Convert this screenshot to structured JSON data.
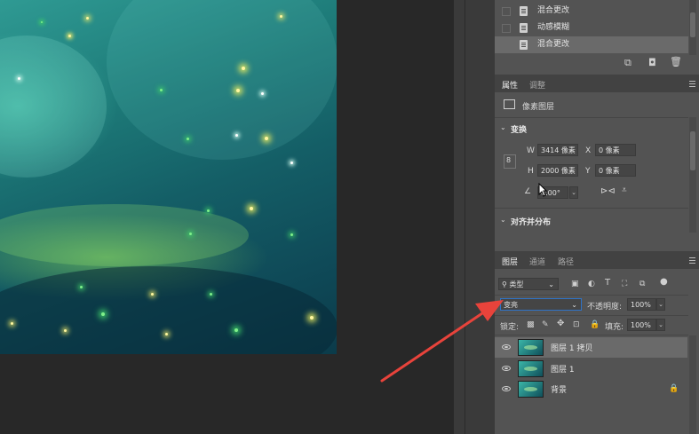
{
  "history": {
    "items": [
      {
        "label": "混合更改",
        "selected": false
      },
      {
        "label": "动感模糊",
        "selected": false
      },
      {
        "label": "混合更改",
        "selected": true
      }
    ],
    "footer_icons": [
      "new-snapshot-icon",
      "camera-icon",
      "trash-icon"
    ]
  },
  "properties": {
    "tabs": [
      "属性",
      "调整"
    ],
    "active_tab": "属性",
    "layer_kind": "像素图层",
    "transform": {
      "section_title": "变换",
      "w_label": "W",
      "w_value": "3414 像素",
      "x_label": "X",
      "x_value": "0 像素",
      "h_label": "H",
      "h_value": "2000 像素",
      "y_label": "Y",
      "y_value": "0 像素",
      "angle_value": "0.00°"
    },
    "align_section_title": "对齐并分布"
  },
  "layers": {
    "tabs": [
      "图层",
      "通道",
      "路径"
    ],
    "active_tab": "图层",
    "filter_label": "类型",
    "blend_mode": "变亮",
    "opacity_label": "不透明度:",
    "opacity_value": "100%",
    "lock_label": "锁定:",
    "fill_label": "填充:",
    "fill_value": "100%",
    "items": [
      {
        "name": "图层 1 拷贝",
        "selected": true,
        "locked": false
      },
      {
        "name": "图层 1",
        "selected": false,
        "locked": false
      },
      {
        "name": "背景",
        "selected": false,
        "locked": true
      }
    ]
  },
  "annotation": {
    "arrow_color": "#e8433b"
  }
}
